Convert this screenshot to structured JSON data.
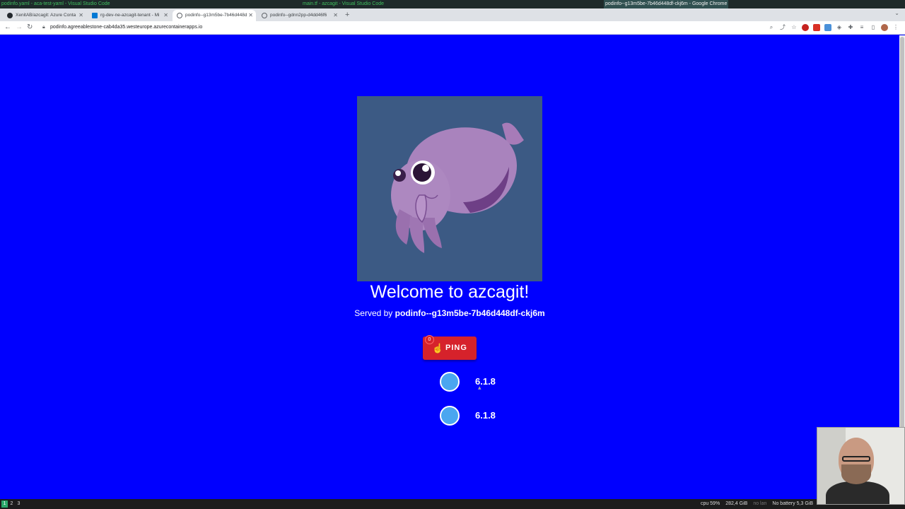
{
  "wm": {
    "left_title": "podinfo.yaml - aca-test-yaml - Visual Studio Code",
    "mid_title": "main.tf - azcagit - Visual Studio Code",
    "right_title": "podinfo--g13m5be-7b46d448df-ckj6m - Google Chrome"
  },
  "tabs": [
    {
      "title": "XenitAB/azcagit: Azure Conta",
      "favicon": "github-icon",
      "color": "#24292e"
    },
    {
      "title": "rg-dev-ne-azcagit-tenant - Mi",
      "favicon": "azure-icon",
      "color": "#0078d4"
    },
    {
      "title": "podinfo--g13m5be-7b46d448d",
      "favicon": "globe-icon",
      "color": "#5f6368"
    },
    {
      "title": "podinfo--gdnn2pp-d4dd46f6",
      "favicon": "globe-icon",
      "color": "#5f6368"
    }
  ],
  "toolbar": {
    "url": "podinfo.agreeablestone-cab4da35.westeurope.azurecontainerapps.io"
  },
  "page": {
    "welcome": "Welcome to azcagit!",
    "served_prefix": "Served by ",
    "served_pod": "podinfo--g13m5be-7b46d448df-ckj6m",
    "ping_label": "PING",
    "ping_count": "0",
    "versions": [
      "6.1.8",
      "6.1.8"
    ]
  },
  "status": {
    "workspaces": [
      "1",
      "2",
      "3"
    ],
    "cpu": "cpu  59%",
    "mem": "282,4 GiB",
    "lan": "no lan",
    "battery": "No battery  5,3 GiB"
  },
  "colors": {
    "page_bg": "#0000ff",
    "ping_red": "#d6222b",
    "dot_blue": "#4aa6f0",
    "logo_bg": "#3c5a84"
  }
}
